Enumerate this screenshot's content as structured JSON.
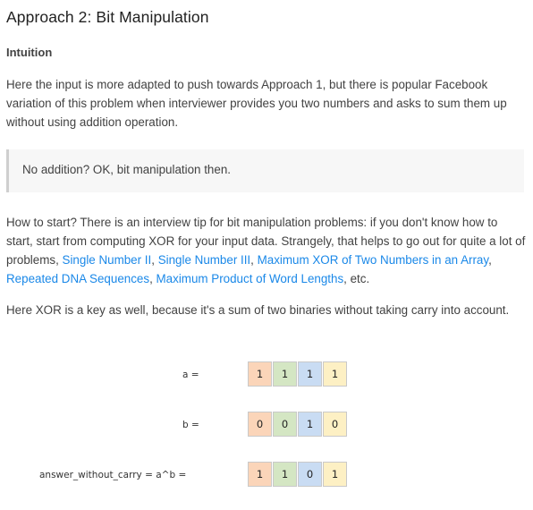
{
  "heading": "Approach 2: Bit Manipulation",
  "subheading": "Intuition",
  "p1": "Here the input is more adapted to push towards Approach 1, but there is popular Facebook variation of this problem when interviewer provides you two numbers and asks to sum them up without using addition operation.",
  "quote": "No addition? OK, bit manipulation then.",
  "p2": {
    "before": "How to start? There is an interview tip for bit manipulation problems: if you don't know how to start, start from computing XOR for your input data. Strangely, that helps to go out for quite a lot of problems, ",
    "links": [
      "Single Number II",
      "Single Number III",
      "Maximum XOR of Two Numbers in an Array",
      "Repeated DNA Sequences",
      "Maximum Product of Word Lengths"
    ],
    "after": ", etc."
  },
  "p3": "Here XOR is a key as well, because it's a sum of two binaries without taking carry into account.",
  "figure": {
    "rows": [
      {
        "label": "a =",
        "bits": [
          "1",
          "1",
          "1",
          "1"
        ]
      },
      {
        "label": "b =",
        "bits": [
          "0",
          "0",
          "1",
          "0"
        ]
      },
      {
        "label": "answer_without_carry = a^b =",
        "bits": [
          "1",
          "1",
          "0",
          "1"
        ]
      }
    ],
    "bit_colors": [
      "#fbd5b9",
      "#d4e6c3",
      "#c9dcf3",
      "#fdf0c4"
    ]
  }
}
